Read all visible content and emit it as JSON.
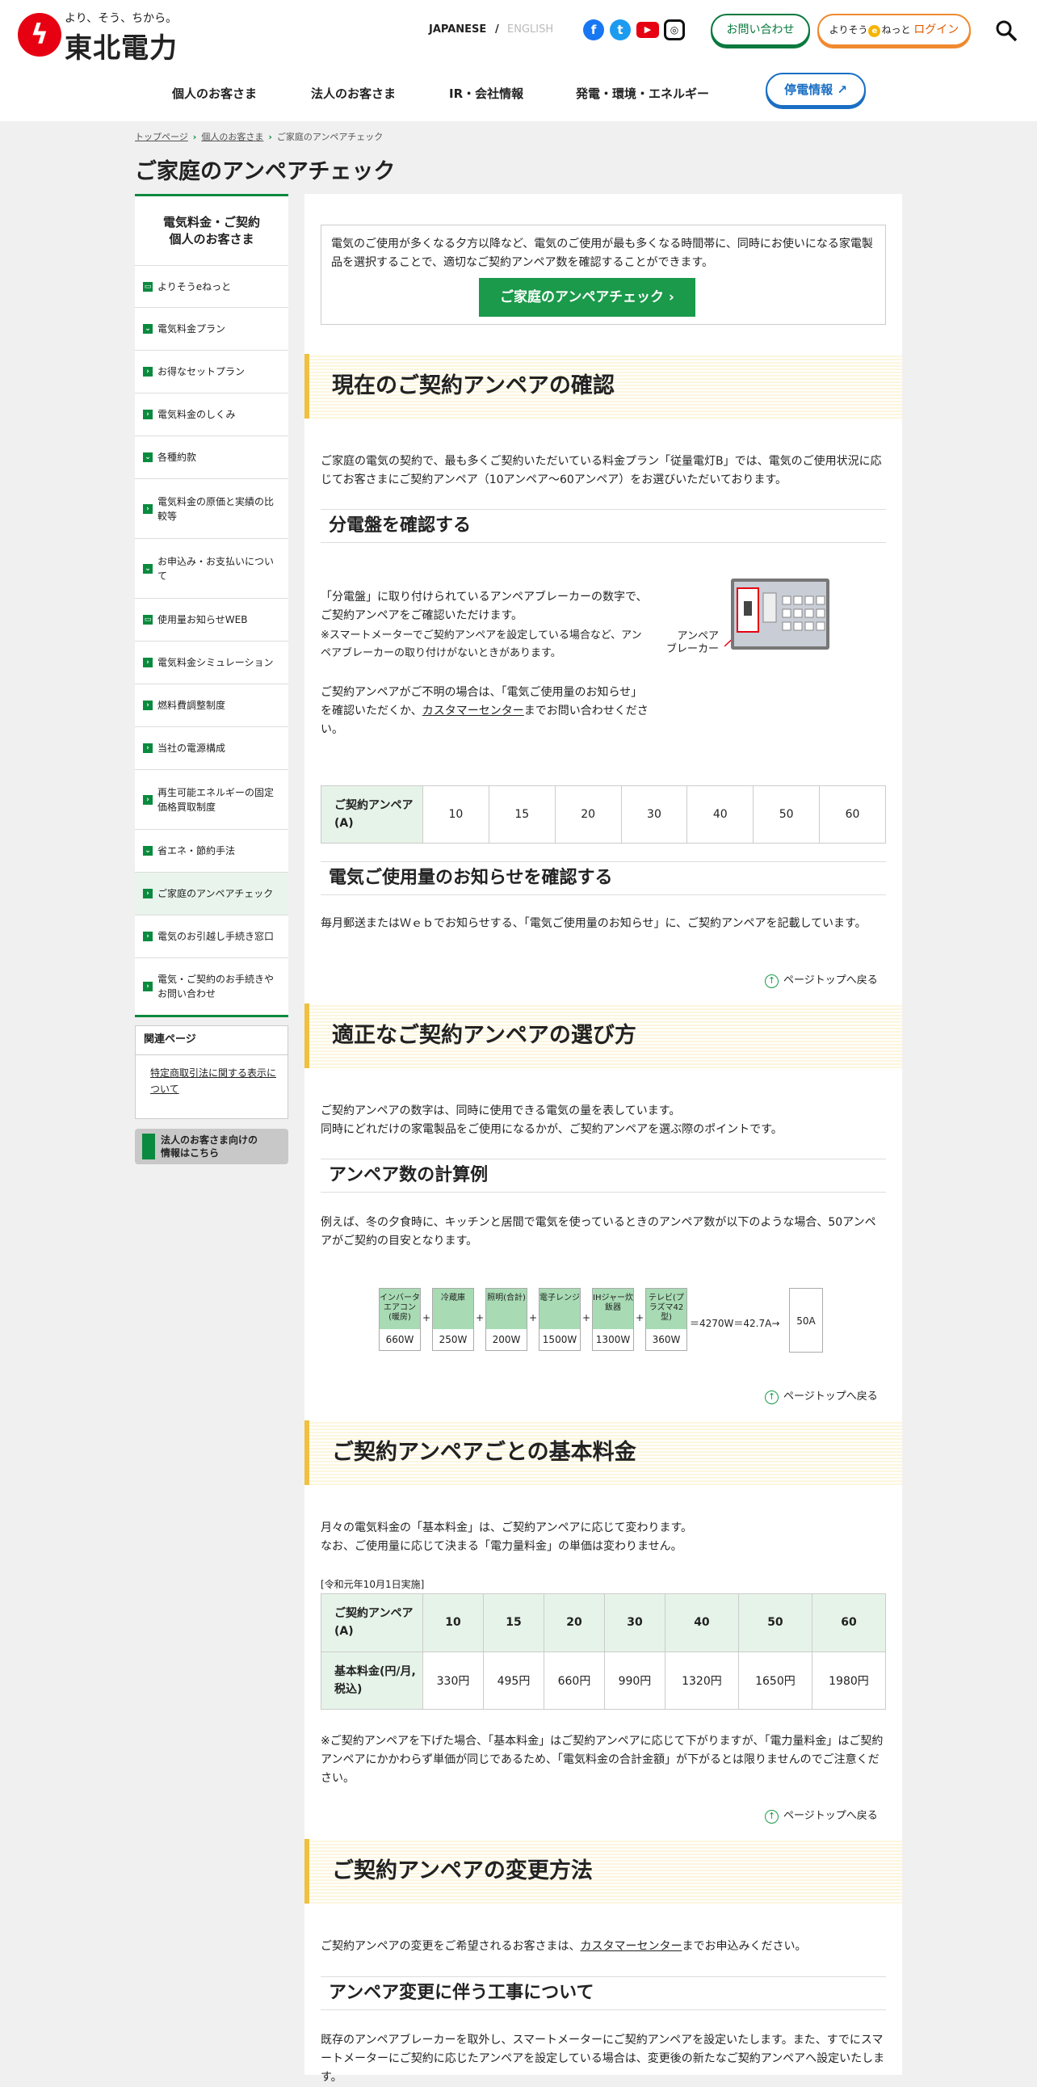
{
  "header": {
    "tagline": "より、そう、ちから。",
    "logo_name": "東北電力",
    "lang_ja": "JAPANESE",
    "lang_sep": "/",
    "lang_en": "ENGLISH",
    "contact": "お問い合わせ",
    "login_prefix": "よりそう",
    "login_mid": "e",
    "login_suffix": "ねっと",
    "login_word": "ログイン",
    "nav": [
      "個人のお客さま",
      "法人のお客さま",
      "IR・会社情報",
      "発電・環境・エネルギー"
    ],
    "outage": "停電情報"
  },
  "breadcrumb": [
    "トップページ",
    "個人のお客さま",
    "ご家庭のアンペアチェック"
  ],
  "page_title": "ご家庭のアンペアチェック",
  "sidebar": {
    "head_line1": "電気料金・ご契約",
    "head_line2": "個人のお客さま",
    "items": [
      "よりそうeねっと",
      "電気料金プラン",
      "お得なセットプラン",
      "電気料金のしくみ",
      "各種約款",
      "電気料金の原価と実績の比較等",
      "お申込み・お支払いについて",
      "使用量お知らせWEB",
      "電気料金シミュレーション",
      "燃料費調整制度",
      "当社の電源構成",
      "再生可能エネルギーの固定価格買取制度",
      "省エネ・節約手法",
      "ご家庭のアンペアチェック",
      "電気のお引越し手続き窓口",
      "電気・ご契約のお手続きやお問い合わせ"
    ],
    "related_head": "関連ページ",
    "related_link": "特定商取引法に関する表示について",
    "corp_line1": "法人のお客さま向けの",
    "corp_line2": "情報はこちら"
  },
  "intro": {
    "text": "電気のご使用が多くなる夕方以降など、電気のご使用が最も多くなる時間帯に、同時にお使いになる家電製品を選択することで、適切なご契約アンペア数を確認することができます。",
    "button": "ご家庭のアンペアチェック"
  },
  "sec1": {
    "title": "現在のご契約アンペアの確認",
    "p1": "ご家庭の電気の契約で、最も多くご契約いただいている料金プラン「従量電灯B」では、電気のご使用状況に応じてお客さまにご契約アンペア（10アンペア～60アンペア）をお選びいただいております。",
    "h3a": "分電盤を確認する",
    "p2": "「分電盤」に取り付けられているアンペアブレーカーの数字で、ご契約アンペアをご確認いただけます。",
    "p2note": "※スマートメーターでご契約アンペアを設定している場合など、アンペアブレーカーの取り付けがないときがあります。",
    "p3a": "ご契約アンペアがご不明の場合は、「電気ご使用量のお知らせ」を確認いただくか、",
    "p3link": "カスタマーセンター",
    "p3b": "までお問い合わせください。",
    "breaker_label1": "アンペア",
    "breaker_label2": "ブレーカー",
    "table_head": "ご契約アンペア(A)",
    "table_values": [
      "10",
      "15",
      "20",
      "30",
      "40",
      "50",
      "60"
    ],
    "h3b": "電気ご使用量のお知らせを確認する",
    "p4": "毎月郵送またはＷｅｂでお知らせする、「電気ご使用量のお知らせ」に、ご契約アンペアを記載しています。"
  },
  "pagetop": "ページトップへ戻る",
  "sec2": {
    "title": "適正なご契約アンペアの選び方",
    "p1a": "ご契約アンペアの数字は、同時に使用できる電気の量を表しています。",
    "p1b": "同時にどれだけの家電製品をご使用になるかが、ご契約アンペアを選ぶ際のポイントです。",
    "h3": "アンペア数の計算例",
    "p2": "例えば、冬の夕食時に、キッチンと居間で電気を使っているときのアンペア数が以下のような場合、50アンペアがご契約の目安となります。",
    "calc": [
      {
        "label": "インバータエアコン(暖房)",
        "value": "660W"
      },
      {
        "label": "冷蔵庫",
        "value": "250W"
      },
      {
        "label": "照明(合計)",
        "value": "200W"
      },
      {
        "label": "電子レンジ",
        "value": "1500W"
      },
      {
        "label": "IHジャー炊飯器",
        "value": "1300W"
      },
      {
        "label": "テレビ(プラズマ42型)",
        "value": "360W"
      }
    ],
    "calc_total": "＝4270W＝42.7A→",
    "calc_result": "50A"
  },
  "sec3": {
    "title": "ご契約アンペアごとの基本料金",
    "p1a": "月々の電気料金の「基本料金」は、ご契約アンペアに応じて変わります。",
    "p1b": "なお、ご使用量に応じて決まる「電力量料金」の単価は変わりません。",
    "effective": "[令和元年10月1日実施]",
    "row1_head": "ご契約アンペア(A)",
    "amps": [
      "10",
      "15",
      "20",
      "30",
      "40",
      "50",
      "60"
    ],
    "row2_head": "基本料金(円/月,税込)",
    "fees": [
      "330円",
      "495円",
      "660円",
      "990円",
      "1320円",
      "1650円",
      "1980円"
    ],
    "note": "※ご契約アンペアを下げた場合、「基本料金」はご契約アンペアに応じて下がりますが、「電力量料金」はご契約アンペアにかかわらず単価が同じであるため、「電気料金の合計金額」が下がるとは限りませんのでご注意ください。"
  },
  "sec4": {
    "title": "ご契約アンペアの変更方法",
    "p1a": "ご契約アンペアの変更をご希望されるお客さまは、",
    "p1link": "カスタマーセンター",
    "p1b": "までお申込みください。",
    "h3": "アンペア変更に伴う工事について",
    "p2": "既存のアンペアブレーカーを取外し、スマートメーターにご契約アンペアを設定いたします。また、すでにスマートメーターにご契約に応じたアンペアを設定している場合は、変更後の新たなご契約アンペアへ設定いたします。"
  }
}
